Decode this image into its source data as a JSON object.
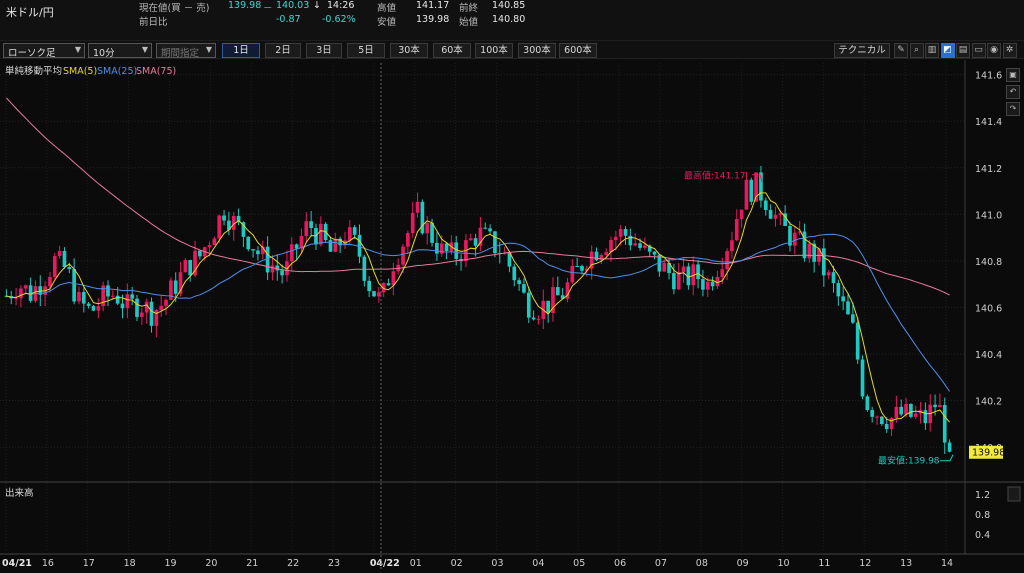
{
  "header": {
    "pair": "米ドル/円",
    "current_label": "現在値(買 － 売)",
    "current_bid": "139.98",
    "current_sep": "－",
    "current_ask": "140.03",
    "arrow": "↓",
    "time": "14:26",
    "change_label": "前日比",
    "change_value": "-0.87",
    "change_pct": "-0.62%",
    "high_label": "高値",
    "high_value": "141.17",
    "low_label": "安値",
    "low_value": "139.98",
    "prev_label": "前終",
    "prev_value": "140.85",
    "open_label": "始値",
    "open_value": "140.80"
  },
  "toolbar": {
    "chart_type": "ローソク足",
    "interval": "10分",
    "period_placeholder": "期間指定",
    "ranges": [
      "1日",
      "2日",
      "3日",
      "5日",
      "30本",
      "60本",
      "100本",
      "300本",
      "600本"
    ],
    "active_range": "1日",
    "technical_label": "テクニカル",
    "tool_icons": [
      "pencil-icon",
      "magnifier-icon",
      "bar-chart-icon",
      "area-chart-icon",
      "document-icon",
      "folder-icon",
      "camera-icon",
      "settings-icon"
    ]
  },
  "legend": {
    "title": "単純移動平均",
    "sma5": "SMA(5)",
    "sma25": "SMA(25)",
    "sma75": "SMA(75)"
  },
  "colors": {
    "up": "#e8195e",
    "down": "#1fc8c0",
    "sma5": "#e6d91c",
    "sma25": "#4f8fe8",
    "sma75": "#e87a9a",
    "price_tag_bg": "#f2ea3c"
  },
  "annotations": {
    "high": "最高値:141.17",
    "low": "最安値:139.98",
    "current_price_tag": "139.98"
  },
  "volume_panel": {
    "title": "出来高",
    "ticks": [
      "1.2",
      "0.8",
      "0.4"
    ]
  },
  "side_icons": [
    "lock-icon",
    "undo-icon",
    "redo-icon"
  ],
  "chart_data": {
    "type": "candlestick",
    "yticks": [
      141.6,
      141.4,
      141.2,
      141.0,
      140.8,
      140.6,
      140.4,
      140.2,
      140.0
    ],
    "ylim": [
      139.85,
      141.65
    ],
    "xticks": [
      "04/21",
      "16",
      "17",
      "18",
      "19",
      "20",
      "21",
      "22",
      "23",
      "04/22",
      "01",
      "02",
      "03",
      "04",
      "05",
      "06",
      "07",
      "08",
      "09",
      "10",
      "11",
      "12",
      "13",
      "14"
    ],
    "ohlc_anchor": [
      140.65,
      140.7,
      140.66,
      140.72,
      140.8,
      140.76,
      140.62,
      140.58,
      140.64,
      140.66,
      140.6,
      140.62,
      140.58,
      140.62,
      140.7,
      140.78,
      140.82,
      140.92,
      141.02,
      140.95,
      140.9,
      140.82,
      140.78,
      140.74,
      140.86,
      140.96,
      140.9,
      140.82,
      140.92,
      140.86,
      140.7,
      140.62,
      140.8,
      140.9,
      141.0,
      140.92,
      140.84,
      140.82,
      140.86,
      140.92,
      140.88,
      140.84,
      140.74,
      140.62,
      140.6,
      140.62,
      140.66,
      140.74,
      140.82,
      140.86,
      140.9,
      140.92,
      140.88,
      140.82,
      140.78,
      140.74,
      140.72,
      140.74,
      140.7,
      140.8,
      140.92,
      141.1,
      141.12,
      141.05,
      140.95,
      140.9,
      140.85,
      140.82,
      140.72,
      140.62,
      140.5,
      140.2,
      140.15,
      140.12,
      140.14,
      140.13,
      140.12,
      140.2,
      139.98
    ]
  }
}
